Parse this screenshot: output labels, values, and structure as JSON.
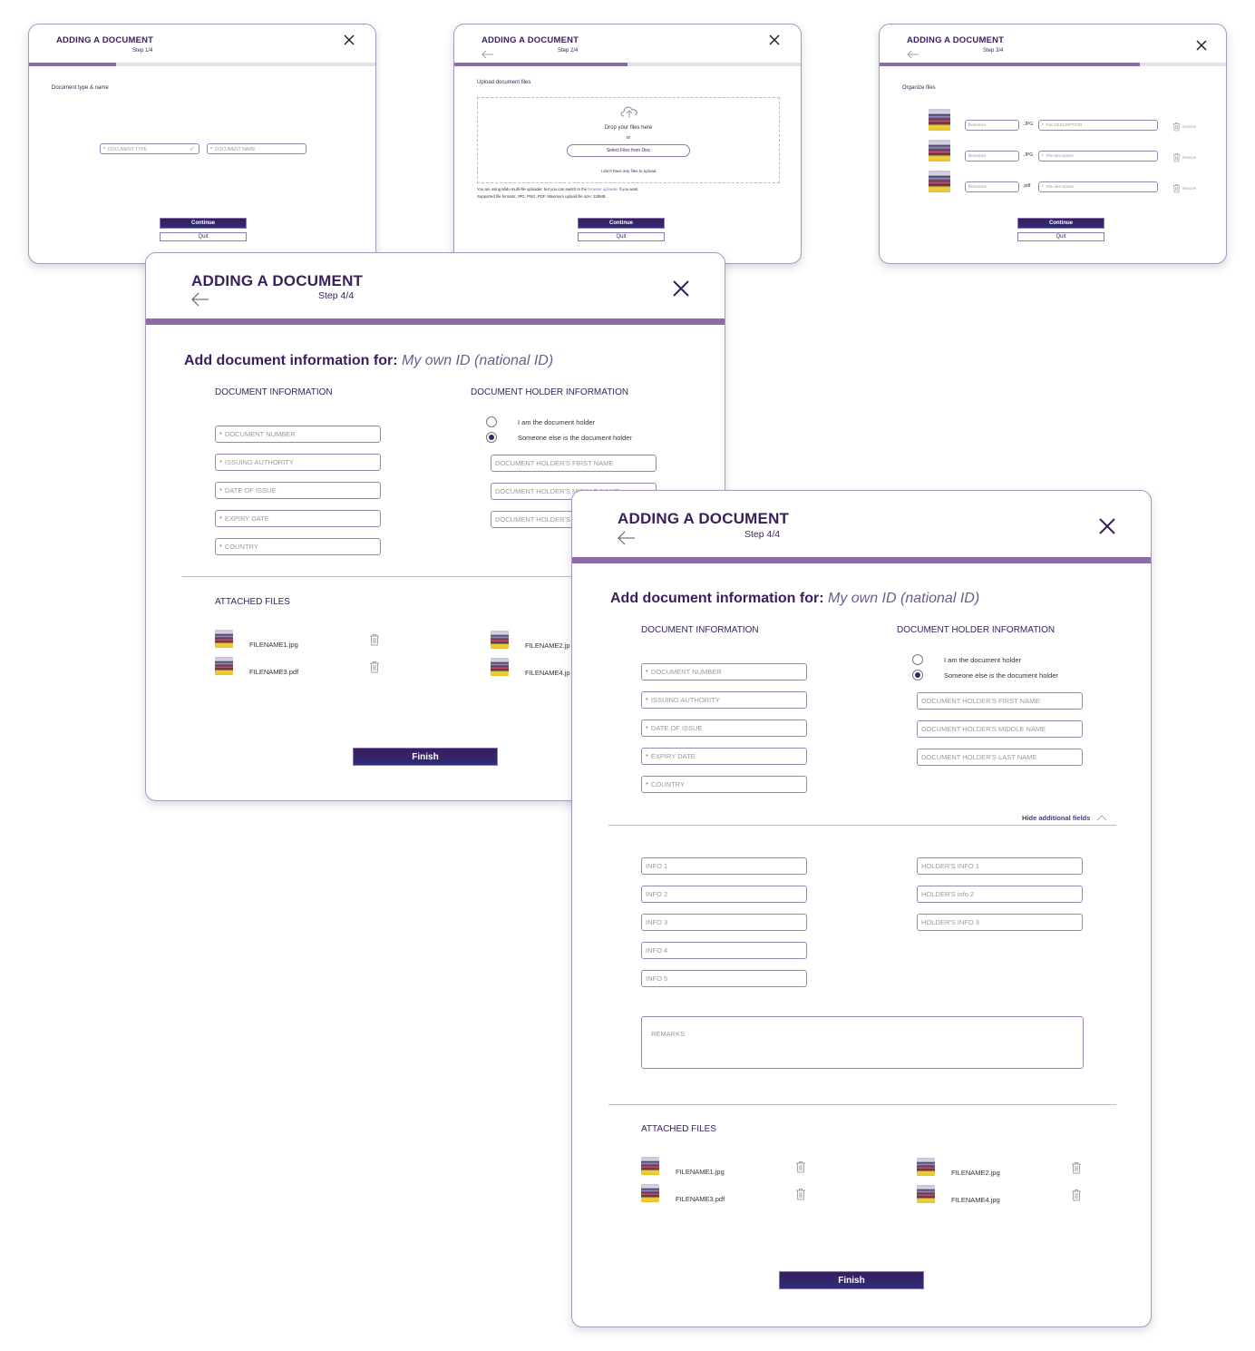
{
  "colors": {
    "brand": "#3a1f5d",
    "progress": "#8c6ba6",
    "button": "#3b1b5e",
    "required": "#e0306a",
    "field_border": "#9b86b3"
  },
  "common": {
    "title": "ADDING A DOCUMENT",
    "continue_label": "Continue",
    "quit_label": "Quit",
    "finish_label": "Finish",
    "close_icon": "close-icon",
    "back_icon": "arrow-left-icon",
    "required_mark": "*"
  },
  "step1": {
    "step_label": "Step 1/4",
    "progress": 0.25,
    "section_label": "Document type & name",
    "document_type_placeholder": "DOCUMENT TYPE",
    "document_name_placeholder": "DOCUMENT NAME"
  },
  "step2": {
    "step_label": "Step 2/4",
    "progress": 0.5,
    "section_label": "Upload document files",
    "drop_text": "Drop your files here",
    "or_text": "or",
    "select_button": "Select Files from Disc",
    "no_files_link": "I don't have any files to upload",
    "info_prefix": "You are using Mido multi-file uploader, but you can switch to the ",
    "info_link": "browser uploader",
    "info_suffix": " if you want.",
    "formats_text": "Supported file formats: JPG, PNG, PDF. Maximum upload file size: 128MB."
  },
  "step3": {
    "step_label": "Step 3/4",
    "progress": 0.75,
    "section_label": "Organize files",
    "remove_label": "REMOVE",
    "files": [
      {
        "name": "filename1",
        "ext": ".JPG",
        "description_placeholder": "File DESCRIPTION"
      },
      {
        "name": "filename2",
        "ext": ".JPG",
        "description_placeholder": "File description"
      },
      {
        "name": "filename3",
        "ext": ".pdf",
        "description_placeholder": "File description"
      }
    ]
  },
  "step4": {
    "step_label": "Step 4/4",
    "progress": 1.0,
    "heading_prefix": "Add document information for: ",
    "heading_doc": "My own ID (national ID)",
    "doc_info_label": "DOCUMENT INFORMATION",
    "holder_info_label": "DOCUMENT HOLDER INFORMATION",
    "doc_fields": [
      "DOCUMENT NUMBER",
      "ISSUING AUTHORITY",
      "DATE OF ISSUE",
      "EXPIRY DATE",
      "COUNTRY"
    ],
    "radio_options": [
      {
        "label": "I am the document holder",
        "selected": false
      },
      {
        "label": "Someone else is the document holder",
        "selected": true
      }
    ],
    "holder_fields": [
      "DOCUMENT HOLDER'S FIRST NAME",
      "DOCUMENT HOLDER'S MIDDLE NAME",
      "DOCUMENT HOLDER'S LAST NAME"
    ],
    "hide_fields_link": "Hide additional fields",
    "info_fields": [
      "INFO 1",
      "INFO 2",
      "INFO 3",
      "INFO 4",
      "INFO 5"
    ],
    "holder_info_fields": [
      "HOLDER'S INFO 1",
      "HOLDER'S info 2",
      "HOLDER'S INFO 3"
    ],
    "remarks_placeholder": "REMARKS",
    "attached_label": "ATTACHED FILES",
    "attached_files": [
      "FILENAME1.jpg",
      "FILENAME2.jpg",
      "FILENAME3.pdf",
      "FILENAME4.jpg"
    ],
    "attached_files_collapsed": [
      "FILENAME1.jpg",
      "FILENAME2.jp",
      "FILENAME3.pdf",
      "FILENAME4.jp"
    ]
  }
}
